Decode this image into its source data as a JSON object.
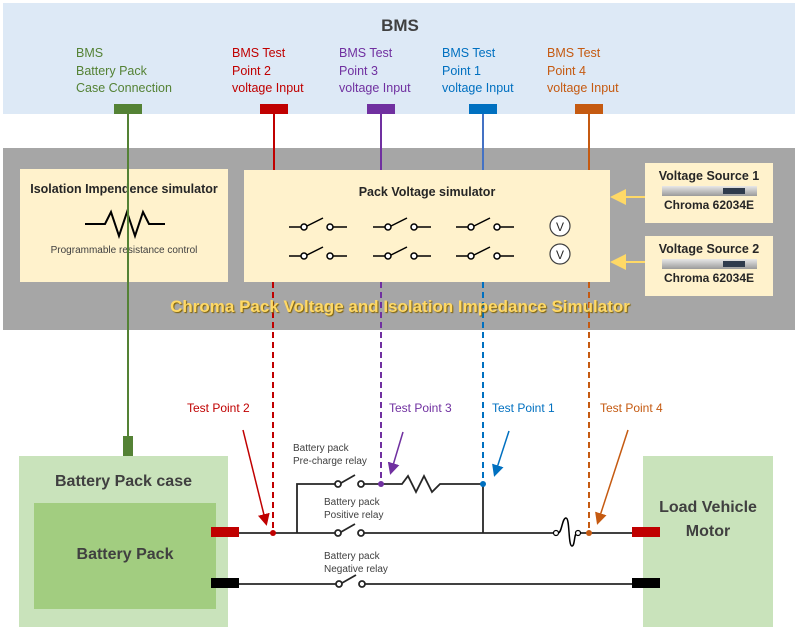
{
  "bms": {
    "title": "BMS",
    "labels": [
      {
        "lines": [
          "BMS",
          "Battery Pack",
          "Case Connection"
        ],
        "color": "#548235"
      },
      {
        "lines": [
          "BMS Test",
          "Point 2",
          "voltage Input"
        ],
        "color": "#c00000"
      },
      {
        "lines": [
          "BMS Test",
          "Point 3",
          "voltage Input"
        ],
        "color": "#7030a0"
      },
      {
        "lines": [
          "BMS Test",
          "Point 1",
          "voltage Input"
        ],
        "color": "#0070c0"
      },
      {
        "lines": [
          "BMS Test",
          "Point 4",
          "voltage Input"
        ],
        "color": "#c55a11"
      }
    ]
  },
  "simulator": {
    "title": "Chroma Pack Voltage and Isolation Impedance Simulator",
    "isolation": {
      "title": "Isolation Impendence simulator",
      "caption": "Programmable resistance control",
      "icon": "resistor-icon"
    },
    "pack_voltage": {
      "title": "Pack Voltage simulator",
      "switch_rows": 2,
      "switch_cols": 3,
      "meter_label": "V"
    },
    "sources": [
      {
        "title": "Voltage Source 1",
        "model": "Chroma 62034E"
      },
      {
        "title": "Voltage Source 2",
        "model": "Chroma 62034E"
      }
    ]
  },
  "circuit": {
    "test_points": [
      {
        "label": "Test Point 2",
        "color": "#c00000"
      },
      {
        "label": "Test Point 3",
        "color": "#7030a0"
      },
      {
        "label": "Test Point 1",
        "color": "#0070c0"
      },
      {
        "label": "Test Point 4",
        "color": "#c55a11"
      }
    ],
    "relays": {
      "precharge": [
        "Battery pack",
        "Pre-charge relay"
      ],
      "positive": [
        "Battery pack",
        "Positive relay"
      ],
      "negative": [
        "Battery pack",
        "Negative relay"
      ]
    },
    "battery_case": "Battery Pack case",
    "battery_pack": "Battery Pack",
    "load": [
      "Load Vehicle",
      "Motor"
    ]
  },
  "colors": {
    "case_green": "#548235",
    "positive_red": "#c00000",
    "negative_black": "#000000",
    "arrow_yellow": "#ffd966"
  }
}
